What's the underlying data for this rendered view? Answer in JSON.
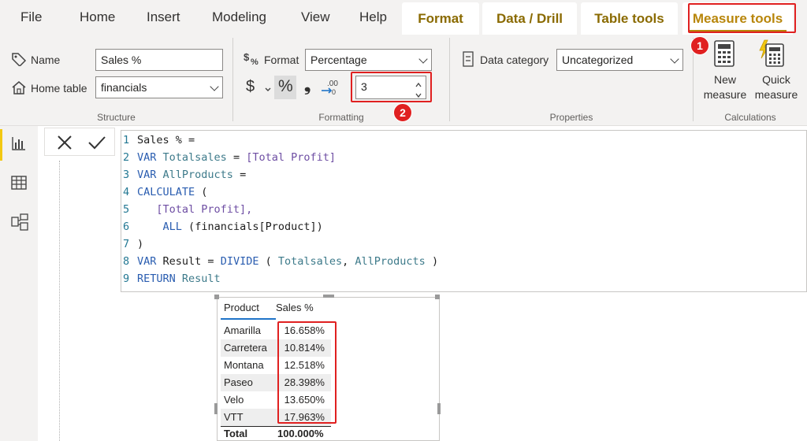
{
  "menu": {
    "file": "File",
    "home": "Home",
    "insert": "Insert",
    "modeling": "Modeling",
    "view": "View",
    "help": "Help",
    "format": "Format",
    "data_drill": "Data / Drill",
    "table_tools": "Table tools",
    "measure_tools": "Measure tools"
  },
  "badges": {
    "one": "1",
    "two": "2"
  },
  "structure": {
    "group_label": "Structure",
    "name_label": "Name",
    "name_value": "Sales %",
    "home_table_label": "Home table",
    "home_table_value": "financials"
  },
  "formatting": {
    "group_label": "Formatting",
    "format_label": "Format",
    "format_value": "Percentage",
    "currency_symbol": "$",
    "percent_symbol": "%",
    "comma_symbol": "❟",
    "decimal_places": "3"
  },
  "properties": {
    "group_label": "Properties",
    "data_category_label": "Data category",
    "data_category_value": "Uncategorized"
  },
  "calculations": {
    "group_label": "Calculations",
    "new_measure_line1": "New",
    "new_measure_line2": "measure",
    "quick_measure_line1": "Quick",
    "quick_measure_line2": "measure"
  },
  "formula": {
    "line_numbers": [
      "1",
      "2",
      "3",
      "4",
      "5",
      "6",
      "7",
      "8",
      "9"
    ],
    "l1": "Sales % =",
    "l2_kw": "VAR",
    "l2_var": "Totalsales",
    "l2_eq": "=",
    "l2_ref": "[Total Profit]",
    "l3_kw": "VAR",
    "l3_var": "AllProducts",
    "l3_eq": "=",
    "l4_fn": "CALCULATE",
    "l4_p": "(",
    "l5_ref": "[Total Profit],",
    "l6_fn": "ALL",
    "l6_p1": "(",
    "l6_tbl": "financials",
    "l6_col": "[Product]",
    "l6_p2": ")",
    "l7": ")",
    "l8_kw": "VAR",
    "l8_a": "Result = ",
    "l8_fn": "DIVIDE",
    "l8_b": " ( ",
    "l8_v1": "Totalsales",
    "l8_c": ", ",
    "l8_v2": "AllProducts",
    "l8_d": " )",
    "l9_kw": "RETURN",
    "l9_var": "Result"
  },
  "table": {
    "col_product": "Product",
    "col_sales": "Sales %",
    "rows": [
      {
        "product": "Amarilla",
        "sales": "16.658%"
      },
      {
        "product": "Carretera",
        "sales": "10.814%"
      },
      {
        "product": "Montana",
        "sales": "12.518%"
      },
      {
        "product": "Paseo",
        "sales": "28.398%"
      },
      {
        "product": "Velo",
        "sales": "13.650%"
      },
      {
        "product": "VTT",
        "sales": "17.963%"
      }
    ],
    "total_label": "Total",
    "total_value": "100.000%"
  }
}
